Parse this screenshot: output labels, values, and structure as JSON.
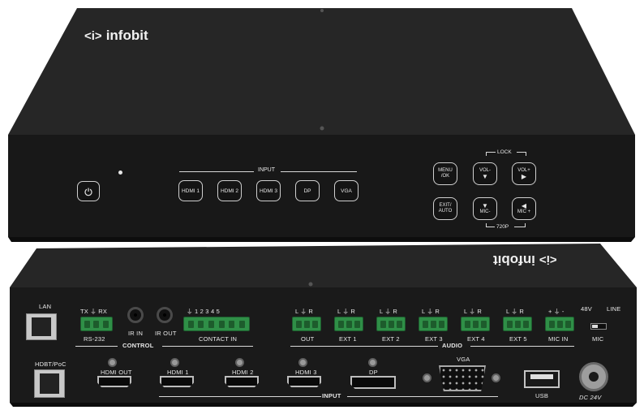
{
  "brand": {
    "logo_text": "infobit",
    "logo_symbol": "<i>"
  },
  "front_panel": {
    "power_icon": "power-icon",
    "input_heading": "INPUT",
    "input_buttons": [
      "HDMI 1",
      "HDMI 2",
      "HDMI 3",
      "DP",
      "VGA"
    ],
    "menu_ok": "MENU\n/OK",
    "exit_auto": "EXIT/\nAUTO",
    "vol_minus": "VOL-",
    "vol_plus": "VOL+",
    "mic_minus": "MIC-",
    "mic_plus": "MIC +",
    "lock_label": "LOCK",
    "res_label": "720P"
  },
  "rear_panel": {
    "brand_mirrored": "infobit",
    "lan": "LAN",
    "rs232_pins": "TX  ⏚  RX",
    "rs232": "RS-232",
    "ir_in": "IR IN",
    "ir_out": "IR OUT",
    "contact_pins": "⏚  1   2   3   4   5",
    "contact_in": "CONTACT IN",
    "control": "CONTROL",
    "audio_pins": "L  ⏚  R",
    "audio_ports": [
      "OUT",
      "EXT 1",
      "EXT 2",
      "EXT 3",
      "EXT 4",
      "EXT 5"
    ],
    "mic_pins": "+  ⏚  -",
    "mic_in": "MIC IN",
    "phantom": "48V",
    "line": "LINE",
    "mic": "MIC",
    "audio": "AUDIO",
    "hdbt": "HDBT/PoC",
    "hdmi_out": "HDMI OUT",
    "hdmi_in": [
      "HDMI 1",
      "HDMI 2",
      "HDMI 3"
    ],
    "dp": "DP",
    "vga": "VGA",
    "usb": "USB",
    "dc": "DC 24V",
    "input": "INPUT"
  },
  "colors": {
    "chassis": "#1b1b1b",
    "top": "#262626",
    "terminal": "#2f8f47",
    "text": "#e8e8e8"
  }
}
